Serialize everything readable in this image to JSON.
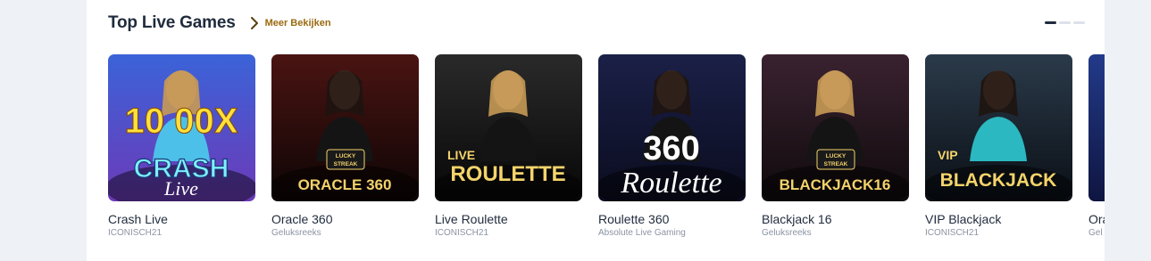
{
  "section": {
    "title": "Top Live Games",
    "more_label": "Meer Bekijken"
  },
  "pager": {
    "pages": 3,
    "active": 0
  },
  "games": [
    {
      "name": "Crash Live",
      "provider": "ICONISCH21",
      "logo_top": "CRASH",
      "logo_sub": "Live",
      "extra": "10 00X",
      "badge": "",
      "theme": {
        "bg1": "#3b63d8",
        "bg2": "#6c3ab8",
        "accent": "#ffe03a"
      }
    },
    {
      "name": "Oracle 360",
      "provider": "Geluksreeks",
      "logo_top": "ORACLE 360",
      "logo_sub": "",
      "extra": "",
      "badge": "LUCKY STREAK",
      "theme": {
        "bg1": "#4a1412",
        "bg2": "#0d0505",
        "accent": "#f3d36b"
      }
    },
    {
      "name": "Live Roulette",
      "provider": "ICONISCH21",
      "logo_top": "ROULETTE",
      "logo_sub": "LIVE",
      "extra": "",
      "badge": "",
      "theme": {
        "bg1": "#2a2a2a",
        "bg2": "#070707",
        "accent": "#f5d46b"
      }
    },
    {
      "name": "Roulette 360",
      "provider": "Absolute Live Gaming",
      "logo_top": "360",
      "logo_sub": "Roulette",
      "extra": "",
      "badge": "",
      "theme": {
        "bg1": "#1b2047",
        "bg2": "#0a0c1e",
        "accent": "#ffffff"
      }
    },
    {
      "name": "Blackjack 16",
      "provider": "Geluksreeks",
      "logo_top": "BLACKJACK16",
      "logo_sub": "",
      "extra": "",
      "badge": "LUCKY STREAK",
      "theme": {
        "bg1": "#3a2230",
        "bg2": "#0f0a0c",
        "accent": "#f3d36b"
      }
    },
    {
      "name": "VIP Blackjack",
      "provider": "ICONISCH21",
      "logo_top": "BLACKJACK",
      "logo_sub": "VIP",
      "extra": "",
      "badge": "",
      "theme": {
        "bg1": "#2b3a4a",
        "bg2": "#0a0f15",
        "accent": "#f5d46b"
      }
    },
    {
      "name": "Ora",
      "provider": "Gel",
      "logo_top": "",
      "logo_sub": "",
      "extra": "",
      "badge": "",
      "theme": {
        "bg1": "#233a8a",
        "bg2": "#0e1540",
        "accent": "#ffffff"
      }
    }
  ]
}
